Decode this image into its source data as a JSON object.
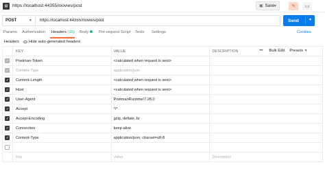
{
  "request": {
    "title": "https://localhost:44355/movies/post",
    "save_label": "Save",
    "method": "POST",
    "url": "https://localhost:44355/movies/post",
    "send_label": "Send"
  },
  "tabs": [
    {
      "label": "Params"
    },
    {
      "label": "Authorization"
    },
    {
      "label": "Headers",
      "count": "(10)"
    },
    {
      "label": "Body"
    },
    {
      "label": "Pre-request Script"
    },
    {
      "label": "Tests"
    },
    {
      "label": "Settings"
    }
  ],
  "cookies_label": "Cookies",
  "subtabs": {
    "headers": "Headers",
    "hide_auto": "Hide auto-generated headers"
  },
  "table": {
    "columns": {
      "key": "KEY",
      "value": "VALUE",
      "description": "DESCRIPTION"
    },
    "actions": {
      "more": "•••",
      "bulk_edit": "Bulk Edit",
      "presets": "Presets"
    },
    "rows": [
      {
        "key": "Postman-Token",
        "value": "<calculated when request is sent>",
        "state": "on",
        "dim": false
      },
      {
        "key": "Content-Type",
        "value": "application/json",
        "state": "dim",
        "dim": true
      },
      {
        "key": "Content-Length",
        "value": "<calculated when request is sent>",
        "state": "on",
        "dim": false
      },
      {
        "key": "Host",
        "value": "<calculated when request is sent>",
        "state": "on",
        "dim": false
      },
      {
        "key": "User-Agent",
        "value": "PostmanRuntime/7.28.0",
        "state": "on",
        "dim": false
      },
      {
        "key": "Accept",
        "value": "*/*",
        "state": "on",
        "dim": false
      },
      {
        "key": "Accept-Encoding",
        "value": "gzip, deflate, br",
        "state": "on",
        "dim": false
      },
      {
        "key": "Connection",
        "value": "keep-alive",
        "state": "on",
        "dim": false
      },
      {
        "key": "Content-Type",
        "value": "application/json; charset=utf-8",
        "state": "on",
        "dim": false
      },
      {
        "key": "",
        "value": "",
        "state": "off",
        "dim": false
      }
    ],
    "new_row": {
      "key_placeholder": "Key",
      "value_placeholder": "Value",
      "description_placeholder": "Description"
    }
  },
  "colors": {
    "accent": "#ff6c37",
    "send": "#097bed",
    "count": "#26b47f"
  }
}
